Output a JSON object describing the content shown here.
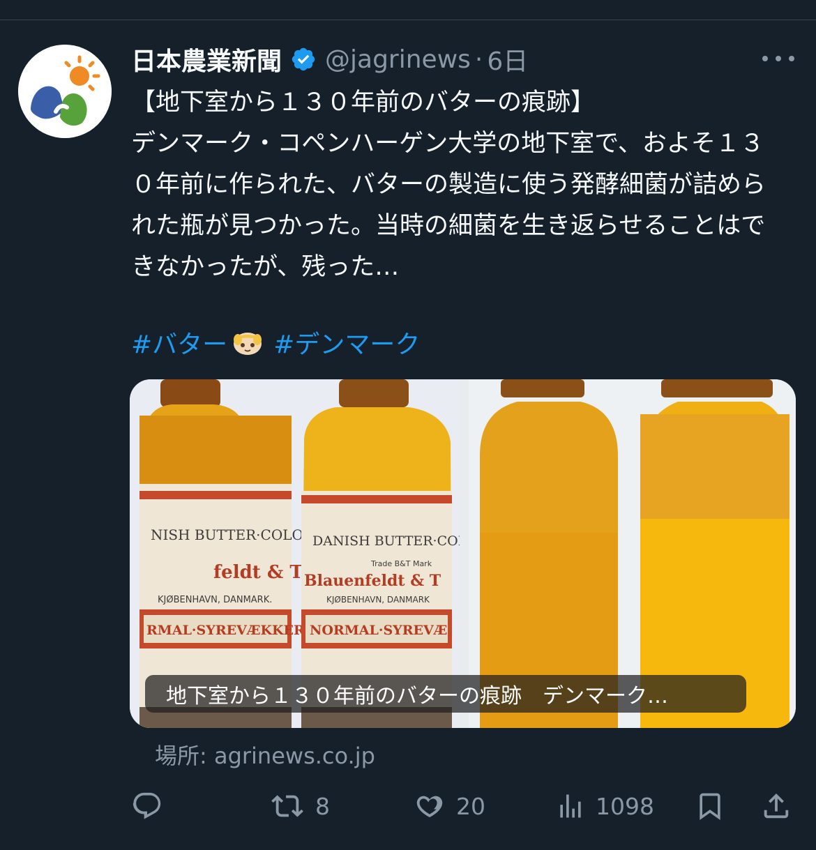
{
  "tweet": {
    "display_name": "日本農業新聞",
    "handle": "@jagrinews",
    "separator": "·",
    "time": "6日",
    "text": "【地下室から１３０年前のバターの痕跡】\nデンマーク・コペンハーゲン大学の地下室で、およそ１３０年前に作られた、バターの製造に使う発酵細菌が詰められた瓶が見つかった。当時の細菌を生き返らせることはできなかったが、残った…",
    "hashtags": [
      "#バター",
      "#デンマーク"
    ]
  },
  "card": {
    "caption": "地下室から１３０年前のバターの痕跡　デンマーク…",
    "source": "場所: agrinews.co.jp",
    "left_image_labels": {
      "line1_left": "NISH BUTTER·COLOUR C°",
      "line1_right": "DANISH BUTTER·COLO",
      "trade_mark": "Trade B&T Mark",
      "maker_left": "feldt & Tvede",
      "maker_right": "Blauenfeldt & T",
      "city_left": "KJØBENHAVN, DANMARK.",
      "city_right": "KJØBENHAVN, DANMARK",
      "product_left": "RMAL·SYREVÆKKER",
      "product_right": "NORMAL·SYREVÆ"
    }
  },
  "actions": {
    "reply_count": "",
    "retweet_count": "8",
    "like_count": "20",
    "view_count": "1098"
  },
  "colors": {
    "background": "#15202b",
    "text": "#f7f9f9",
    "muted": "#8b98a5",
    "link": "#1d9bf0",
    "verified": "#1d9bf0"
  }
}
